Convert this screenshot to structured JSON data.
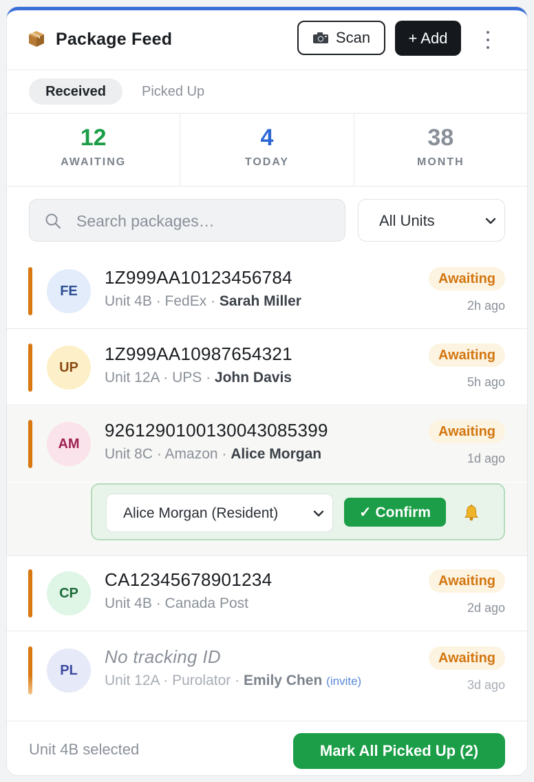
{
  "header": {
    "title": "Package Feed",
    "scan_label": "Scan",
    "add_label": "+ Add"
  },
  "tabs": [
    {
      "label": "Received",
      "active": true
    },
    {
      "label": "Picked Up",
      "active": false
    }
  ],
  "stats": [
    {
      "value": "12",
      "label": "AWAITING",
      "color": "#1b9e47"
    },
    {
      "value": "4",
      "label": "TODAY",
      "color": "#2c67d6"
    },
    {
      "value": "38",
      "label": "MONTH",
      "color": "#8a9099"
    }
  ],
  "search": {
    "placeholder": "Search packages…",
    "value": ""
  },
  "unit_filter": {
    "selected": "All Units"
  },
  "packages": [
    {
      "initials": "FE",
      "tracking": "1Z999AA10123456784",
      "unit": "Unit 4B",
      "carrier": "FedEx",
      "resident": "Sarah Miller",
      "status": "Awaiting",
      "time": "2h ago"
    },
    {
      "initials": "UP",
      "tracking": "1Z999AA10987654321",
      "unit": "Unit 12A",
      "carrier": "UPS",
      "resident": "John Davis",
      "status": "Awaiting",
      "time": "5h ago"
    },
    {
      "initials": "AM",
      "tracking": "9261290100130043085399",
      "unit": "Unit 8C",
      "carrier": "Amazon",
      "resident": "Alice Morgan",
      "status": "Awaiting",
      "time": "1d ago"
    },
    {
      "initials": "CP",
      "tracking": "CA12345678901234",
      "unit": "Unit 4B",
      "carrier": "Canada Post",
      "resident": "",
      "status": "Awaiting",
      "time": "2d ago"
    },
    {
      "initials": "PL",
      "tracking": "No tracking ID",
      "unit": "Unit 12A",
      "carrier": "Purolator",
      "resident": "Emily Chen",
      "invite": "(invite)",
      "status": "Awaiting",
      "time": "3d ago"
    }
  ],
  "confirm_panel": {
    "pickup_by": "Alice Morgan (Resident)",
    "confirm_label": "✓ Confirm"
  },
  "footer": {
    "selection": "Unit 4B selected",
    "mark_all_label": "Mark All Picked Up (2)"
  },
  "colors": {
    "accent_top": "#3a6fd8",
    "awaiting": "#d2760f",
    "confirm_green": "#1b9e47"
  }
}
